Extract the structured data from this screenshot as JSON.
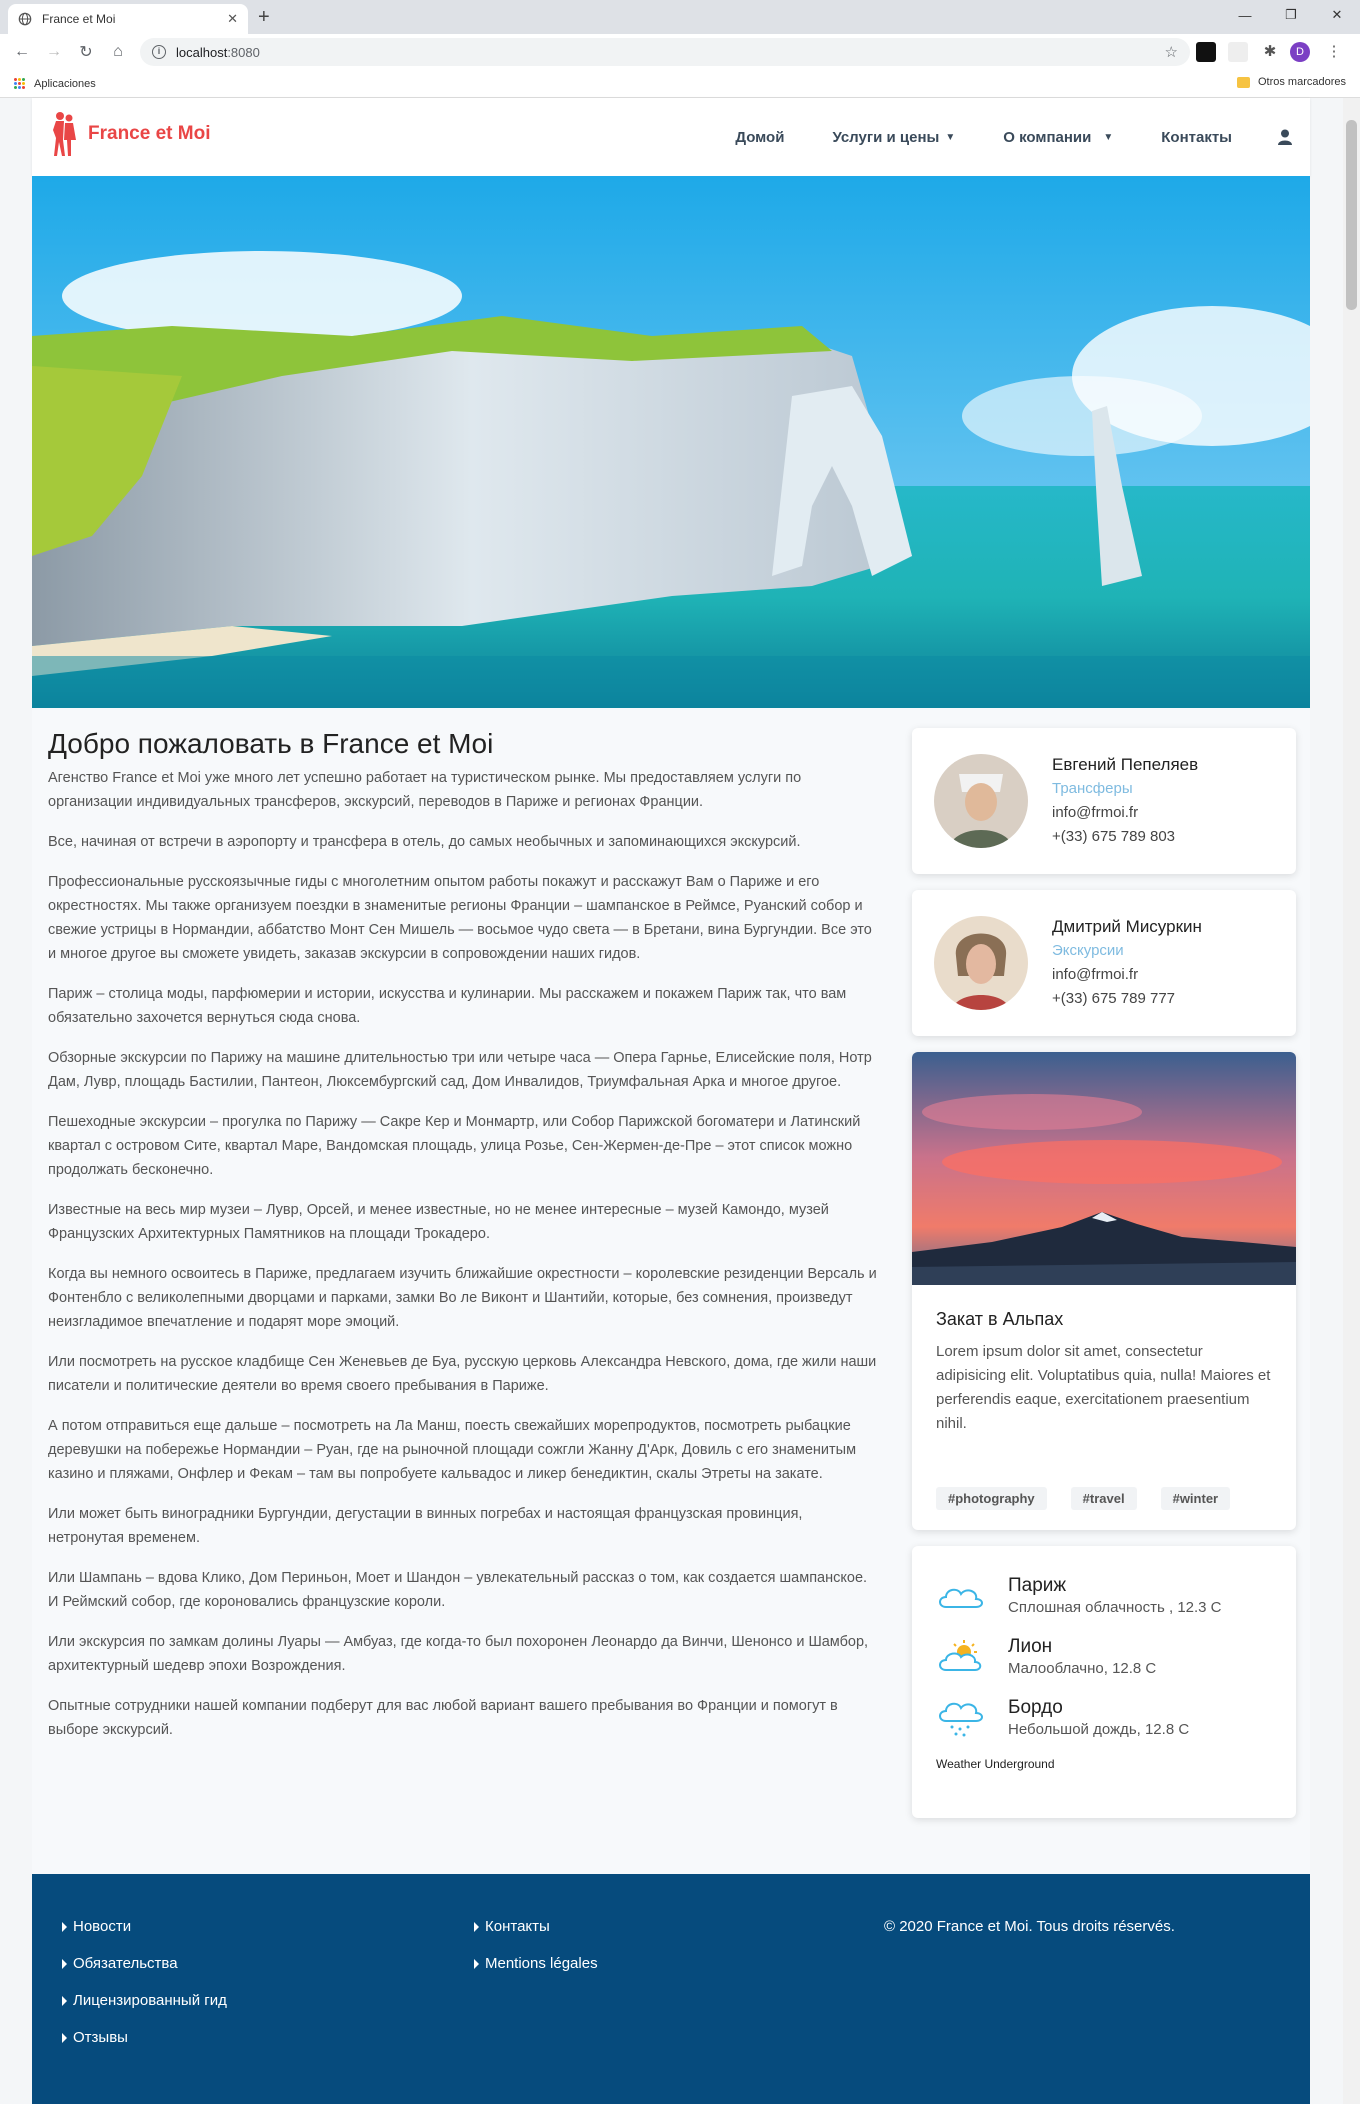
{
  "browser": {
    "tab_title": "France et Moi",
    "url_host": "localhost",
    "url_port": ":8080",
    "profile_initial": "D",
    "bookmarks_apps": "Aplicaciones",
    "bookmarks_other": "Otros marcadores"
  },
  "nav": {
    "brand": "France et Moi",
    "links": [
      "Домой",
      "Услуги и цены",
      "О компании",
      "Контакты"
    ],
    "accent_color": "#e94646"
  },
  "main": {
    "title": "Добро пожаловать в France et Moi",
    "paragraphs": [
      "Агенство France et Moi уже много лет успешно работает на туристическом рынке. Мы предоставляем услуги по организации индивидуальных трансферов, экскурсий, переводов в Париже и регионах Франции.",
      "Все, начиная от встречи в аэропорту и трансфера в отель, до самых необычных и запоминающихся экскурсий.",
      "Профессиональные русскоязычные гиды с многолетним опытом работы покажут и расскажут Вам о Париже и его окрестностях. Мы также организуем поездки в знаменитые регионы Франции – шампанское в Реймсе, Руанский собор и свежие устрицы в Нормандии, аббатство Монт Сен Мишель — восьмое чудо света — в Бретани, вина Бургундии. Все это и многое другое вы сможете увидеть, заказав экскурсии в сопровождении наших гидов.",
      "Париж – столица моды, парфюмерии и истории, искусства и кулинарии. Мы расскажем и покажем Париж так, что вам обязательно захочется вернуться сюда снова.",
      "Обзорные экскурсии по Парижу на машине длительностью три или четыре часа — Опера Гарнье, Елисейские поля, Нотр Дам, Лувр, площадь Бастилии, Пантеон, Люксембургский сад, Дом Инвалидов, Триумфальная Арка и многое другое.",
      "Пешеходные экскурсии – прогулка по Парижу — Сакре Кер и Монмартр, или Собор Парижской богоматери и Латинский квартал с островом Сите, квартал Маре, Вандомская площадь, улица Розье, Сен-Жермен-де-Пре – этот список можно продолжать бесконечно.",
      "Известные на весь мир музеи – Лувр, Орсей, и менее известные, но не менее интересные – музей Камондо, музей Французских Архитектурных Памятников на площади Трокадеро.",
      "Когда вы немного освоитесь в Париже, предлагаем изучить ближайшие окрестности – королевские резиденции Версаль и Фонтенбло с великолепными дворцами и парками, замки Во ле Виконт и Шантийи, которые, без сомнения, произведут неизгладимое впечатление и подарят море эмоций.",
      "Или посмотреть на русское кладбище Сен Женевьев де Буа, русскую церковь Александра Невского, дома, где жили наши писатели и политические деятели во время своего пребывания в Париже.",
      "А потом отправиться еще дальше – посмотреть на Ла Манш, поесть свежайших морепродуктов, посмотреть рыбацкие деревушки на побережье Нормандии – Руан, где на рыночной площади сожгли Жанну Д'Арк, Довиль с его знаменитым казино и пляжами, Онфлер и Фекам – там вы попробуете кальвадос и ликер бенедиктин, скалы Этреты на закате.",
      "Или может быть виноградники Бургундии, дегустации в винных погребах и настоящая французская провинция, нетронутая временем.",
      "Или Шампань – вдова Клико, Дом Периньон, Моет и Шандон – увлекательный рассказ о том, как создается шампанское. И Реймский собор, где короновались французские короли.",
      "Или экскурсия по замкам долины Луары — Амбуаз, где когда-то был похоронен Леонардо да Винчи, Шенонсо и Шамбор, архитектурный шедевр эпохи Возрождения.",
      "Опытные сотрудники нашей компании подберут для вас любой вариант вашего пребывания во Франции и помогут в выборе экскурсий."
    ]
  },
  "contacts": [
    {
      "name": "Евгений Пепеляев",
      "role": "Трансферы",
      "email": "info@frmoi.fr",
      "phone": "+(33) 675 789 803"
    },
    {
      "name": "Дмитрий Мисуркин",
      "role": "Экскурсии",
      "email": "info@frmoi.fr",
      "phone": "+(33) 675 789 777"
    }
  ],
  "photo_card": {
    "title": "Закат в Альпах",
    "text": "Lorem ipsum dolor sit amet, consectetur adipisicing elit. Voluptatibus quia, nulla! Maiores et perferendis eaque, exercitationem praesentium nihil.",
    "tags": [
      "#photography",
      "#travel",
      "#winter"
    ]
  },
  "weather": {
    "items": [
      {
        "city": "Париж",
        "desc": "Сплошная облачность , 12.3 C",
        "icon": "cloud-icon"
      },
      {
        "city": "Лион",
        "desc": "Малооблачно, 12.8 C",
        "icon": "sun-cloud-icon"
      },
      {
        "city": "Бордо",
        "desc": "Небольшой дождь, 12.8 C",
        "icon": "rain-icon"
      }
    ],
    "source": "Weather Underground"
  },
  "footer": {
    "col1": [
      "Новости",
      "Обязательства",
      "Лицензированный гид",
      "Отзывы"
    ],
    "col2": [
      "Контакты",
      "Mentions légales"
    ],
    "copyright": "© 2020 France et Moi. Tous droits réservés.",
    "bg_color": "#064b7d"
  }
}
